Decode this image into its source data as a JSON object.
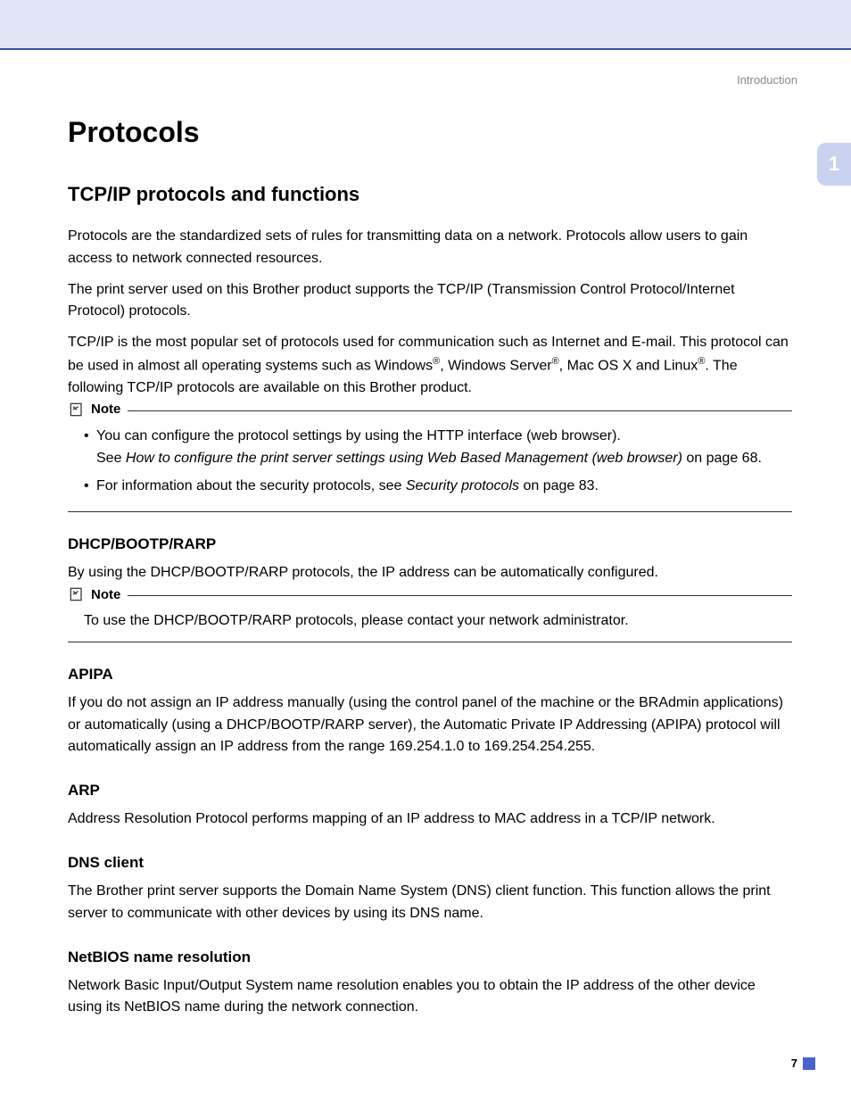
{
  "breadcrumb": "Introduction",
  "chapter_number": "1",
  "page_number": "7",
  "title": "Protocols",
  "subtitle": "TCP/IP protocols and functions",
  "intro": {
    "p1": "Protocols are the standardized sets of rules for transmitting data on a network. Protocols allow users to gain access to network connected resources.",
    "p2": "The print server used on this Brother product supports the TCP/IP (Transmission Control Protocol/Internet Protocol) protocols.",
    "p3a": "TCP/IP is the most popular set of protocols used for communication such as Internet and E-mail. This protocol can be used in almost all operating systems such as Windows",
    "p3b": ", Windows Server",
    "p3c": ", Mac OS X and Linux",
    "p3d": ". The following TCP/IP protocols are available on this Brother product."
  },
  "note_label": "Note",
  "note1": {
    "li1a": "You can configure the protocol settings by using the HTTP interface (web browser).",
    "li1b_pre": "See ",
    "li1b_italic": "How to configure the print server settings using Web Based Management (web browser)",
    "li1b_post": " on page 68.",
    "li2_pre": "For information about the security protocols, see ",
    "li2_italic": "Security protocols",
    "li2_post": " on page 83."
  },
  "sections": {
    "dhcp": {
      "heading": "DHCP/BOOTP/RARP",
      "body": "By using the DHCP/BOOTP/RARP protocols, the IP address can be automatically configured."
    },
    "dhcp_note": "To use the DHCP/BOOTP/RARP protocols, please contact your network administrator.",
    "apipa": {
      "heading": "APIPA",
      "body": "If you do not assign an IP address manually (using the control panel of the machine or the BRAdmin applications) or automatically (using a DHCP/BOOTP/RARP server), the Automatic Private IP Addressing (APIPA) protocol will automatically assign an IP address from the range 169.254.1.0 to 169.254.254.255."
    },
    "arp": {
      "heading": "ARP",
      "body": "Address Resolution Protocol performs mapping of an IP address to MAC address in a TCP/IP network."
    },
    "dns": {
      "heading": "DNS client",
      "body": "The Brother print server supports the Domain Name System (DNS) client function. This function allows the print server to communicate with other devices by using its DNS name."
    },
    "netbios": {
      "heading": "NetBIOS name resolution",
      "body": "Network Basic Input/Output System name resolution enables you to obtain the IP address of the other device using its NetBIOS name during the network connection."
    }
  }
}
